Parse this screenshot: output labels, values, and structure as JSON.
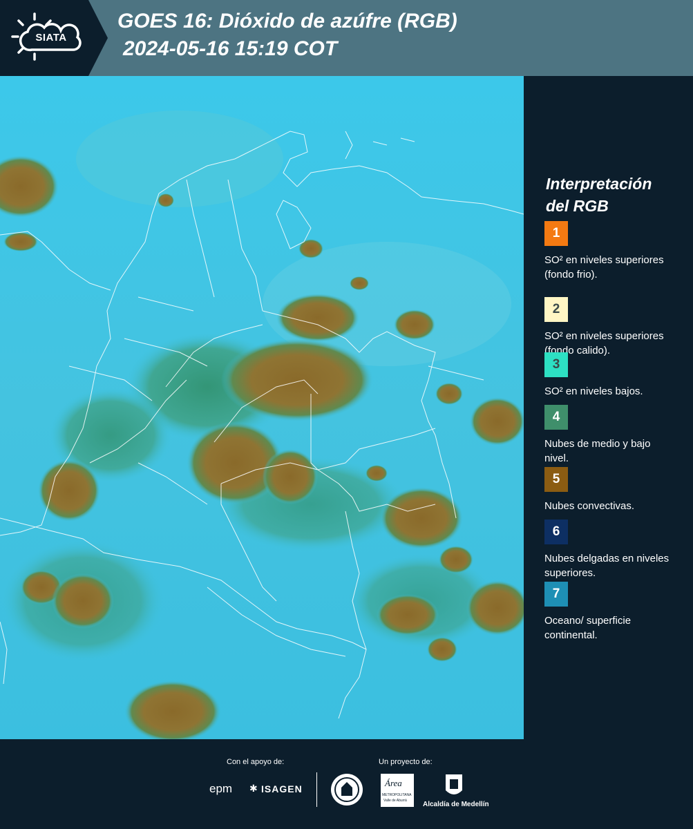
{
  "header": {
    "logo_text": "SIATA",
    "title_line1": "GOES 16: Dióxido de azúfre (RGB)",
    "title_line2": "2024-05-16 15:19 COT"
  },
  "legend": {
    "title_line1": "Interpretación",
    "title_line2": "del RGB",
    "items": [
      {
        "number": "1",
        "color": "#f47a12",
        "text": "SO² en niveles superiores (fondo frio)."
      },
      {
        "number": "2",
        "color": "#fff6c4",
        "text": "SO² en niveles superiores (fondo calido)."
      },
      {
        "number": "3",
        "color": "#2de0c3",
        "text": "SO² en niveles bajos."
      },
      {
        "number": "4",
        "color": "#3f8f6b",
        "text": "Nubes de medio y bajo nivel."
      },
      {
        "number": "5",
        "color": "#8b5c12",
        "text": "Nubes convectivas."
      },
      {
        "number": "6",
        "color": "#0d2f63",
        "text": "Nubes delgadas en niveles superiores."
      },
      {
        "number": "7",
        "color": "#1e8fb5",
        "text": "Oceano/ superficie continental."
      }
    ]
  },
  "footer": {
    "support_label": "Con el apoyo de:",
    "project_label": "Un proyecto de:",
    "sponsor_epm": "epm",
    "sponsor_isagen": "ISAGEN",
    "metro_logo_text": "Área",
    "metro_logo_subtext": "METROPOLITANA",
    "metro_logo_caption": "Valle de Aburrá",
    "alcaldia": "Alcaldía de Medellín"
  },
  "colors": {
    "background": "#0c1e2c",
    "header": "#4d7482",
    "clear_sky": "#3fc6e6",
    "convective": "#8b6a2a"
  }
}
